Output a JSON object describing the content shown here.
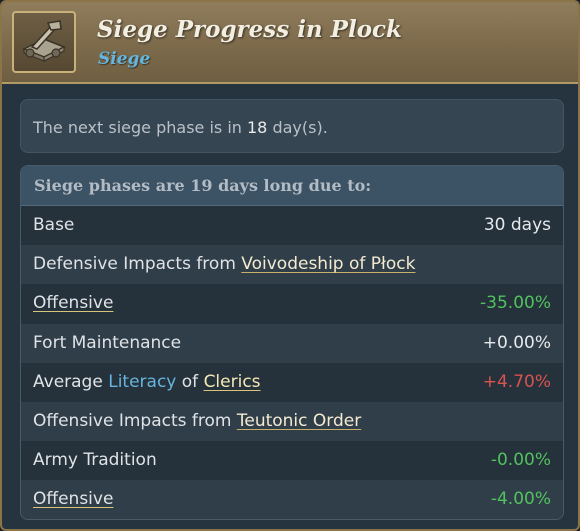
{
  "header": {
    "title": "Siege Progress in Plock",
    "subtitle": "Siege",
    "icon": "catapult-icon"
  },
  "next_phase": {
    "prefix": "The next siege phase is in ",
    "days": "18",
    "suffix": " day(s)."
  },
  "breakdown": {
    "heading": "Siege phases are 19 days long due to:",
    "rows": [
      {
        "label": "Base",
        "value": "30 days"
      },
      {
        "prefix": "Defensive Impacts from ",
        "link": "Voivodeship of Płock"
      },
      {
        "label": "Offensive",
        "value": "-35.00%"
      },
      {
        "label": "Fort Maintenance",
        "value": "+0.00%"
      },
      {
        "p1": "Average ",
        "k1": "Literacy",
        "p2": " of ",
        "k2": "Clerics",
        "value": "+4.70%"
      },
      {
        "prefix": "Offensive Impacts from ",
        "link": "Teutonic Order"
      },
      {
        "label": "Army Tradition",
        "value": "-0.00%"
      },
      {
        "label": "Offensive",
        "value": "-4.00%"
      }
    ]
  },
  "colors": {
    "positive": "#51c25e",
    "negative": "#d9534f",
    "neutral": "#e6e9eb",
    "header_bg": "#7c6a4b",
    "accent_blue": "#67b5de"
  }
}
